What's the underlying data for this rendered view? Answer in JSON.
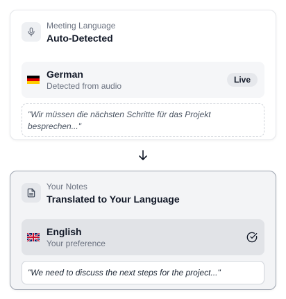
{
  "source": {
    "label": "Meeting Language",
    "title": "Auto-Detected",
    "icon": "microphone-icon",
    "language": {
      "name": "German",
      "subtitle": "Detected from audio",
      "flag": "flag-germany-icon",
      "badge": "Live"
    },
    "quote": "\"Wir müssen die nächsten Schritte für das Projekt besprechen...\""
  },
  "target": {
    "label": "Your Notes",
    "title": "Translated to Your Language",
    "icon": "document-icon",
    "language": {
      "name": "English",
      "subtitle": "Your preference",
      "flag": "flag-uk-icon",
      "status_icon": "check-circle-icon"
    },
    "quote": "\"We need to discuss the next steps for the project...\""
  },
  "colors": {
    "text": "#111827",
    "muted": "#6b7280",
    "card_border": "#e5e7eb",
    "selected_border": "#9ca3af"
  }
}
